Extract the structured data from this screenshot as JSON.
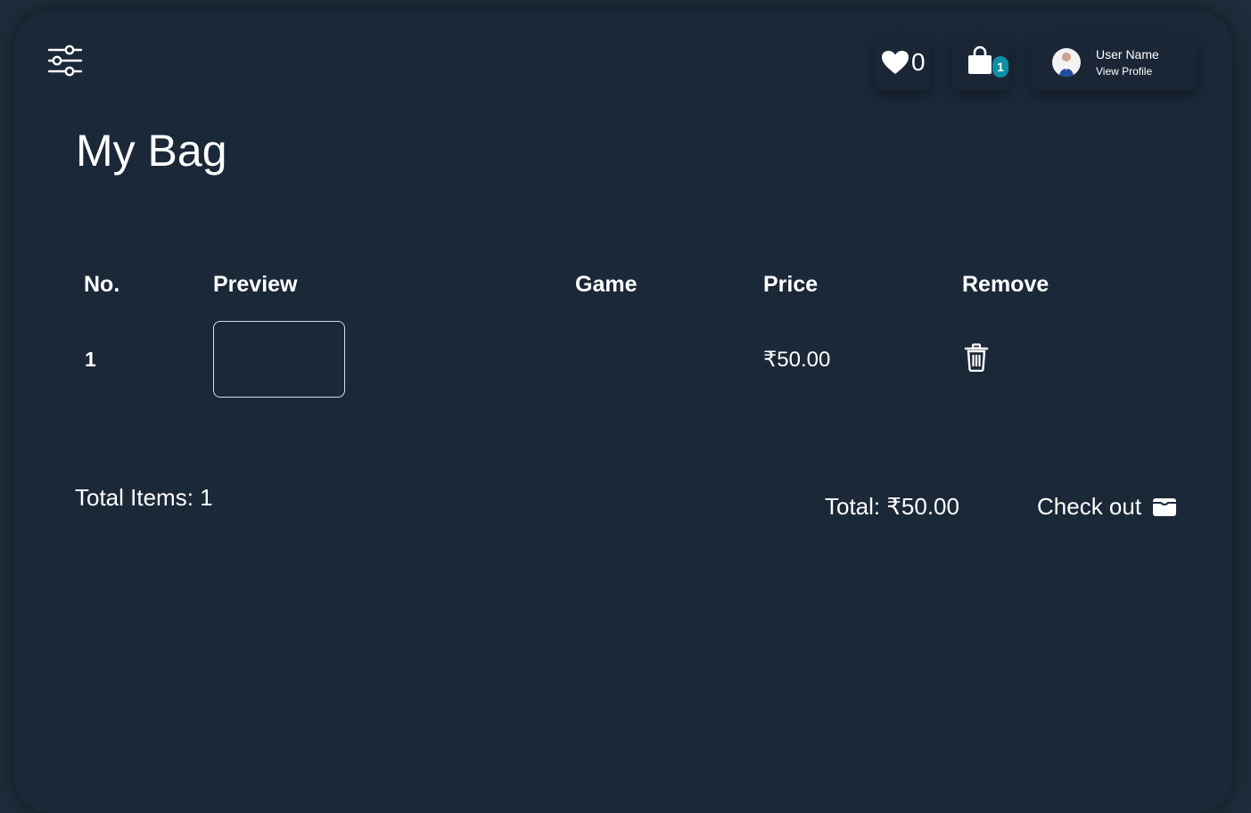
{
  "header": {
    "wishlist_count": "0",
    "bag_count": "1",
    "user_name": "User Name",
    "view_profile": "View Profile"
  },
  "page": {
    "title": "My Bag"
  },
  "table": {
    "columns": [
      "No.",
      "Preview",
      "Game",
      "Price",
      "Remove"
    ],
    "rows": [
      {
        "no": "1",
        "game": "",
        "price": "₹50.00"
      }
    ]
  },
  "summary": {
    "total_items": "Total Items: 1",
    "total": "Total: ₹50.00",
    "checkout_label": "Check out"
  },
  "icons": {
    "filter": "sliders-icon",
    "wishlist": "heart-icon",
    "bag": "shopping-bag-icon",
    "remove": "trash-icon",
    "checkout": "wallet-icon"
  },
  "colors": {
    "background": "#1b2838",
    "badge": "#0e8fa3",
    "text": "#ffffff"
  }
}
